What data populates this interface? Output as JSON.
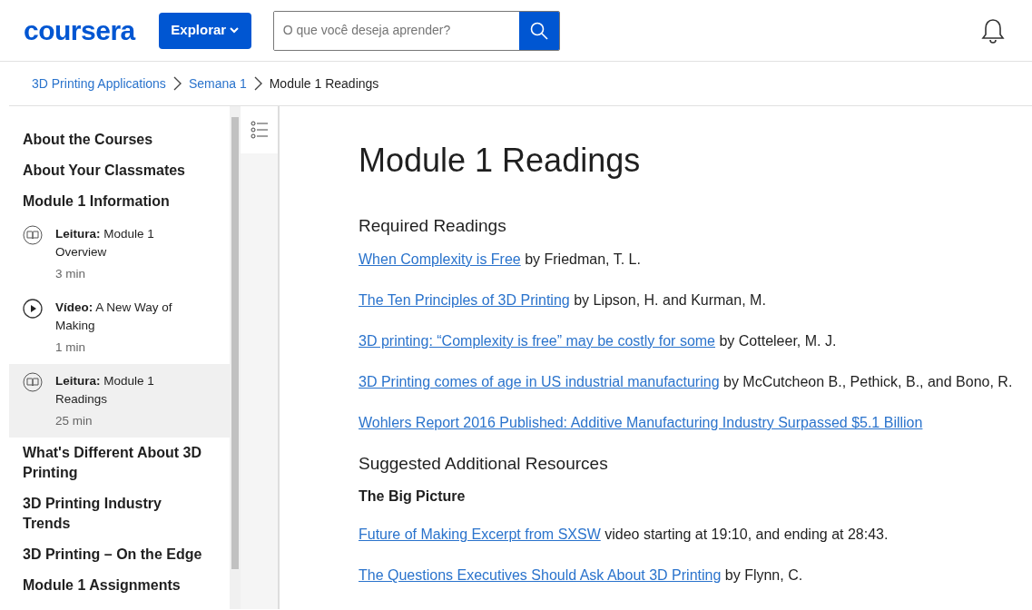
{
  "header": {
    "logo": "coursera",
    "explore_button": "Explorar",
    "search": {
      "placeholder": "O que você deseja aprender?"
    }
  },
  "breadcrumb": [
    {
      "label": "3D Printing Applications",
      "kind": "link"
    },
    {
      "label": "Semana 1",
      "kind": "link"
    },
    {
      "label": "Module 1 Readings",
      "kind": "current"
    }
  ],
  "sidebar": {
    "items": [
      {
        "kind": "section",
        "label": "About the Courses"
      },
      {
        "kind": "section",
        "label": "About Your Classmates"
      },
      {
        "kind": "section",
        "label": "Module 1 Information"
      },
      {
        "kind": "reading",
        "type_label": "Leitura:",
        "label": "Module 1 Overview",
        "duration": "3 min",
        "selected": false
      },
      {
        "kind": "video",
        "type_label": "Vídeo:",
        "label": "A New Way of Making",
        "duration": "1 min",
        "selected": false
      },
      {
        "kind": "reading",
        "type_label": "Leitura:",
        "label": "Module 1 Readings",
        "duration": "25 min",
        "selected": true
      },
      {
        "kind": "section",
        "label": "What's Different About 3D Printing"
      },
      {
        "kind": "section",
        "label": "3D Printing Industry Trends"
      },
      {
        "kind": "section",
        "label": "3D Printing – On the Edge"
      },
      {
        "kind": "section",
        "label": "Module 1 Assignments"
      }
    ]
  },
  "content": {
    "title": "Module 1 Readings",
    "blocks": [
      {
        "kind": "heading",
        "text": "Required Readings"
      },
      {
        "kind": "reference",
        "link": "When Complexity is Free",
        "rest": " by Friedman, T. L."
      },
      {
        "kind": "reference",
        "link": "The Ten Principles of 3D Printing",
        "rest": " by Lipson, H. and Kurman, M."
      },
      {
        "kind": "reference",
        "link": "3D printing: “Complexity is free” may be costly for some",
        "rest": " by Cotteleer, M. J."
      },
      {
        "kind": "reference",
        "link": "3D Printing comes of age in US industrial manufacturing",
        "rest": " by McCutcheon B., Pethick, B., and Bono, R."
      },
      {
        "kind": "reference",
        "link": "Wohlers Report 2016 Published: Additive Manufacturing Industry Surpassed $5.1 Billion"
      },
      {
        "kind": "heading",
        "text": "Suggested Additional Resources"
      },
      {
        "kind": "subheading",
        "text": "The Big Picture"
      },
      {
        "kind": "reference",
        "link": "Future of Making Excerpt from SXSW",
        "rest": " video starting at 19:10, and ending at 28:43."
      },
      {
        "kind": "reference",
        "link": "The Questions Executives Should Ask About 3D Printing",
        "rest": " by Flynn, C."
      }
    ]
  }
}
